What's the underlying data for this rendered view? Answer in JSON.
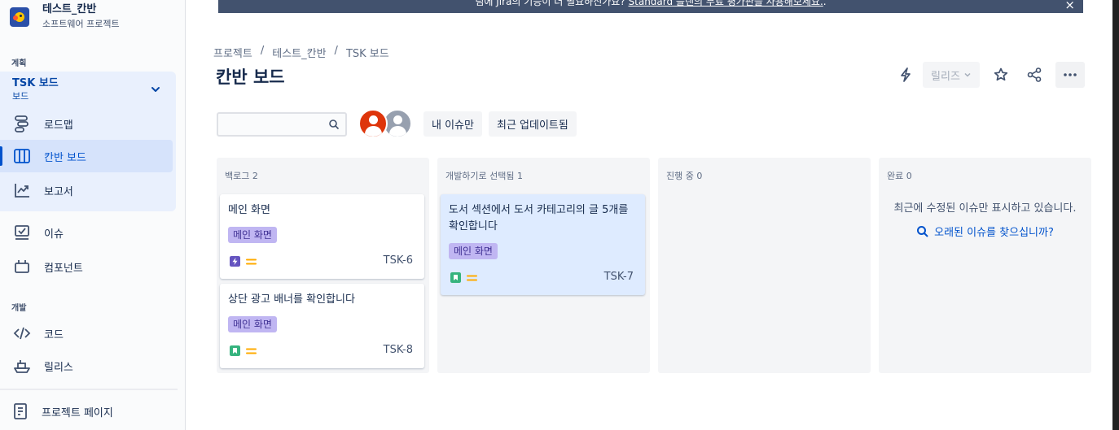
{
  "sidebar": {
    "project_name": "테스트_칸반",
    "project_type": "소프트웨어 프로젝트",
    "section_plan": "계획",
    "board_name": "TSK 보드",
    "board_sub": "보드",
    "items": [
      {
        "label": "로드맵",
        "icon": "roadmap-icon"
      },
      {
        "label": "칸반 보드",
        "icon": "board-icon"
      },
      {
        "label": "보고서",
        "icon": "reports-icon"
      },
      {
        "label": "이슈",
        "icon": "issues-icon"
      },
      {
        "label": "컴포넌트",
        "icon": "components-icon"
      }
    ],
    "section_dev": "개발",
    "dev_items": [
      {
        "label": "코드",
        "icon": "code-icon"
      },
      {
        "label": "릴리스",
        "icon": "ship-icon"
      }
    ],
    "project_page": "프로젝트 페이지"
  },
  "banner": {
    "text_before": "팀에 Jira의 기능이 더 필요하신가요?",
    "link": "Standard 플랜의 무료 평가판을 사용해보세요.",
    "text_after": ".",
    "close": "×"
  },
  "breadcrumb": [
    "프로젝트",
    "테스트_칸반",
    "TSK 보드"
  ],
  "breadcrumb_sep": "/",
  "page_title": "칸반 보드",
  "toolbar": {
    "release_label": "릴리즈"
  },
  "search": {
    "value": "",
    "placeholder": ""
  },
  "filters": {
    "mine": "내 이슈만",
    "recent": "최근 업데이트됨"
  },
  "columns": [
    {
      "title": "백로그",
      "count": "2",
      "cards": [
        {
          "title": "메인 화면",
          "label": "메인 화면",
          "type": "epic",
          "key": "TSK-6"
        },
        {
          "title": "상단 광고 배너를 확인합니다",
          "label": "메인 화면",
          "type": "story",
          "key": "TSK-8"
        }
      ]
    },
    {
      "title": "개발하기로 선택됨",
      "count": "1",
      "cards": [
        {
          "title": "도서 섹션에서 도서 카테고리의 글 5개를 확인합니다",
          "label": "메인 화면",
          "type": "story",
          "key": "TSK-7"
        }
      ]
    },
    {
      "title": "진행 중",
      "count": "0",
      "cards": []
    },
    {
      "title": "완료",
      "count": "0",
      "cards": [],
      "message": "최근에 수정된 이슈만 표시하고 있습니다.",
      "link": "오래된 이슈를 찾으십니까?"
    }
  ],
  "colors": {
    "accent": "#0052cc",
    "epic": "#6554c0",
    "story": "#36b37e",
    "priority_medium": "#ffab00",
    "label_bg": "#c0b6f2"
  }
}
